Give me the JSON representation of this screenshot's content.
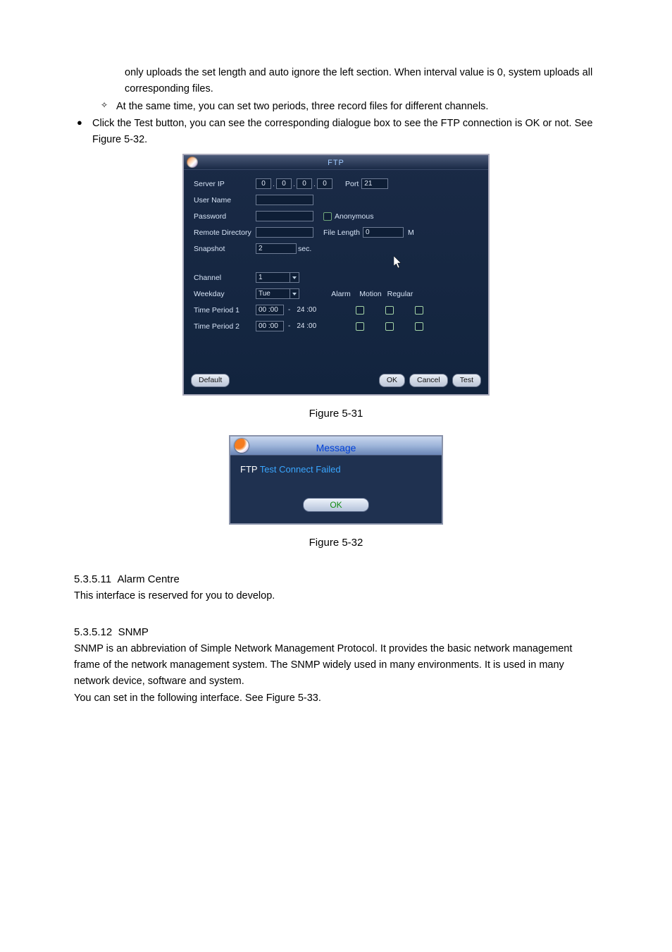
{
  "doc": {
    "p1_part2": "only uploads the set length and auto ignore the left section. When interval value is 0, system uploads all corresponding files.",
    "diamond1": "At the same time, you can set two periods, three record files for different channels.",
    "bullet1": "Click the Test button, you can see the corresponding dialogue box to see the FTP connection is OK or not.  See Figure 5-32."
  },
  "ftp": {
    "title": "FTP",
    "labels": {
      "server_ip": "Server IP",
      "user_name": "User Name",
      "password": "Password",
      "remote_dir": "Remote Directory",
      "file_length": "File Length",
      "snapshot": "Snapshot",
      "channel": "Channel",
      "weekday": "Weekday",
      "tp1": "Time Period 1",
      "tp2": "Time Period 2",
      "anonymous": "Anonymous",
      "port": "Port",
      "sec": "sec.",
      "m": "M"
    },
    "ip": [
      "0",
      "0",
      "0",
      "0"
    ],
    "port": "21",
    "file_length": "0",
    "snapshot": "2",
    "channel": "1",
    "weekday": "Tue",
    "cols": {
      "alarm": "Alarm",
      "motion": "Motion",
      "regular": "Regular"
    },
    "tp1_from": "00 :00",
    "tp1_to": "24 :00",
    "tp2_from": "00 :00",
    "tp2_to": "24 :00",
    "buttons": {
      "default": "Default",
      "ok": "OK",
      "cancel": "Cancel",
      "test": "Test"
    }
  },
  "fig31": "Figure 5-31",
  "msg": {
    "title": "Message",
    "text_prefix": "FTP",
    "text_rest": " Test Connect Failed",
    "ok": "OK"
  },
  "fig32": "Figure 5-32",
  "sec_alarm": {
    "num": "5.3.5.11",
    "title": "Alarm Centre",
    "body": "This interface is reserved for you to develop."
  },
  "sec_snmp": {
    "num": "5.3.5.12",
    "title": "SNMP",
    "body": "SNMP is an abbreviation of Simple Network Management Protocol. It provides the basic network management frame of the network management system. The SNMP widely used in many environments. It is used in many network device, software and system.",
    "body2": "You can set in the following interface. See Figure 5-33."
  }
}
